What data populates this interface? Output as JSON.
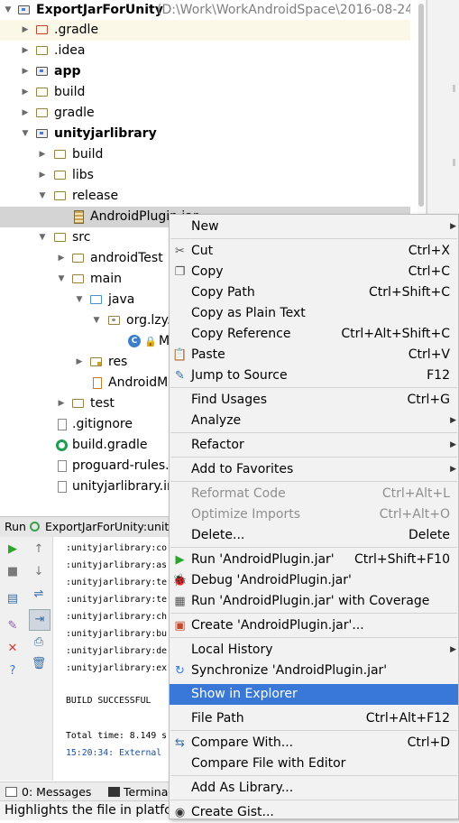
{
  "tree": {
    "root": {
      "name": "ExportJarForUnity",
      "path": "(D:\\Work\\WorkAndroidSpace\\2016-08-24"
    },
    "items": [
      {
        "label": ".gradle"
      },
      {
        "label": ".idea"
      },
      {
        "label": "app"
      },
      {
        "label": "build"
      },
      {
        "label": "gradle"
      },
      {
        "label": "unityjarlibrary"
      },
      {
        "label": "build"
      },
      {
        "label": "libs"
      },
      {
        "label": "release"
      },
      {
        "label": "AndroidPlugin.jar"
      },
      {
        "label": "src"
      },
      {
        "label": "androidTest"
      },
      {
        "label": "main"
      },
      {
        "label": "java"
      },
      {
        "label": "org.lzy."
      },
      {
        "label": "M"
      },
      {
        "label": "res"
      },
      {
        "label": "AndroidM"
      },
      {
        "label": "test"
      },
      {
        "label": ".gitignore"
      },
      {
        "label": "build.gradle"
      },
      {
        "label": "proguard-rules.p"
      },
      {
        "label": "unityjarlibrary.in"
      }
    ]
  },
  "run": {
    "tab_label": "Run",
    "config_label": "ExportJarForUnity:unityj",
    "console_lines": [
      ":unityjarlibrary:co",
      ":unityjarlibrary:as",
      ":unityjarlibrary:te",
      ":unityjarlibrary:te",
      ":unityjarlibrary:ch",
      ":unityjarlibrary:bu",
      ":unityjarlibrary:de",
      ":unityjarlibrary:ex"
    ],
    "build_result": "BUILD SUCCESSFUL",
    "total_time": "Total time: 8.149 s",
    "external": "15:20:34: External"
  },
  "bottom_tabs": [
    {
      "label": "0: Messages"
    },
    {
      "label": "Termina"
    }
  ],
  "status": {
    "text": "Highlights the file in platfc"
  },
  "menu": {
    "items": [
      {
        "label": "New",
        "shortcut": "",
        "submenu": true
      },
      {
        "label": "Cut",
        "shortcut": "Ctrl+X"
      },
      {
        "label": "Copy",
        "shortcut": "Ctrl+C"
      },
      {
        "label": "Copy Path",
        "shortcut": "Ctrl+Shift+C"
      },
      {
        "label": "Copy as Plain Text",
        "shortcut": ""
      },
      {
        "label": "Copy Reference",
        "shortcut": "Ctrl+Alt+Shift+C"
      },
      {
        "label": "Paste",
        "shortcut": "Ctrl+V"
      },
      {
        "label": "Jump to Source",
        "shortcut": "F12"
      },
      {
        "label": "Find Usages",
        "shortcut": "Ctrl+G"
      },
      {
        "label": "Analyze",
        "shortcut": "",
        "submenu": true
      },
      {
        "label": "Refactor",
        "shortcut": "",
        "submenu": true
      },
      {
        "label": "Add to Favorites",
        "shortcut": "",
        "submenu": true
      },
      {
        "label": "Reformat Code",
        "shortcut": "Ctrl+Alt+L",
        "disabled": true
      },
      {
        "label": "Optimize Imports",
        "shortcut": "Ctrl+Alt+O",
        "disabled": true
      },
      {
        "label": "Delete...",
        "shortcut": "Delete"
      },
      {
        "label": "Run 'AndroidPlugin.jar'",
        "shortcut": "Ctrl+Shift+F10"
      },
      {
        "label": "Debug 'AndroidPlugin.jar'",
        "shortcut": ""
      },
      {
        "label": "Run 'AndroidPlugin.jar' with Coverage",
        "shortcut": ""
      },
      {
        "label": "Create 'AndroidPlugin.jar'...",
        "shortcut": ""
      },
      {
        "label": "Local History",
        "shortcut": "",
        "submenu": true
      },
      {
        "label": "Synchronize 'AndroidPlugin.jar'",
        "shortcut": ""
      },
      {
        "label": "Show in Explorer",
        "shortcut": "",
        "highlighted": true
      },
      {
        "label": "File Path",
        "shortcut": "Ctrl+Alt+F12"
      },
      {
        "label": "Compare With...",
        "shortcut": "Ctrl+D"
      },
      {
        "label": "Compare File with Editor",
        "shortcut": ""
      },
      {
        "label": "Add As Library...",
        "shortcut": ""
      },
      {
        "label": "Create Gist...",
        "shortcut": ""
      }
    ]
  },
  "colors": {
    "highlight": "#3a78d8",
    "selected_row": "#d4d4d4",
    "menu_bg": "#f2f2f2"
  }
}
